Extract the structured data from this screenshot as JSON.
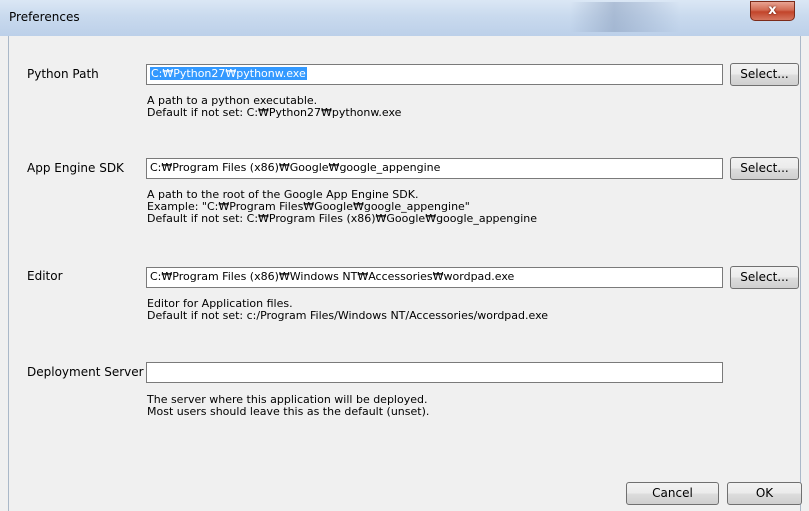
{
  "window": {
    "title": "Preferences",
    "close_label": "x"
  },
  "python_path": {
    "label": "Python Path",
    "value": "C:₩Python27₩pythonw.exe",
    "button": "Select...",
    "help": [
      "A path to a python executable.",
      "Default if not set: C:₩Python27₩pythonw.exe"
    ]
  },
  "app_engine_sdk": {
    "label": "App Engine SDK",
    "value": "C:₩Program Files (x86)₩Google₩google_appengine",
    "button": "Select...",
    "help": [
      "A path to the root of the Google App Engine SDK.",
      "Example: \"C:₩Program Files₩Google₩google_appengine\"",
      "Default if not set: C:₩Program Files (x86)₩Google₩google_appengine"
    ]
  },
  "editor": {
    "label": "Editor",
    "value": "C:₩Program Files (x86)₩Windows NT₩Accessories₩wordpad.exe",
    "button": "Select...",
    "help": [
      "Editor for Application files.",
      "Default if not set: c:/Program Files/Windows NT/Accessories/wordpad.exe"
    ]
  },
  "deployment_server": {
    "label": "Deployment Server",
    "value": "",
    "help": [
      "The server where this application will be deployed.",
      "Most users should leave this as the default (unset)."
    ]
  },
  "footer": {
    "cancel": "Cancel",
    "ok": "OK"
  }
}
